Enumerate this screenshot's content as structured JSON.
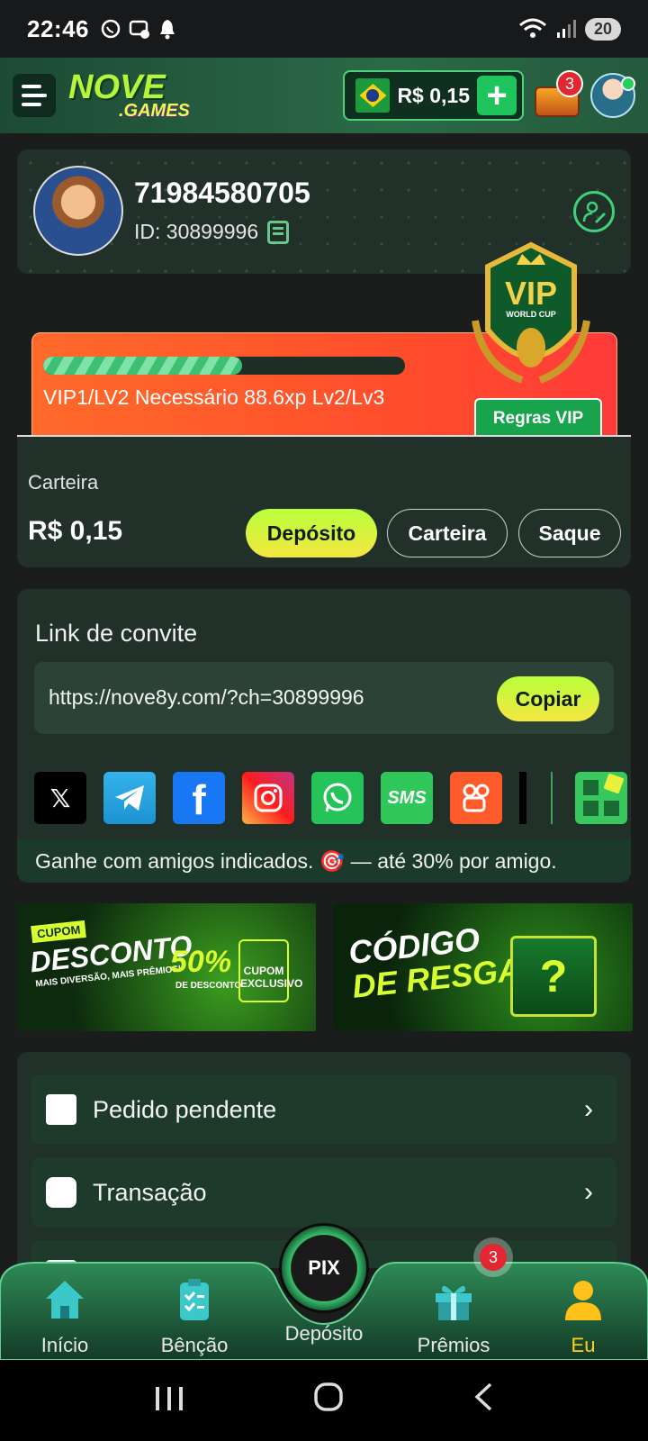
{
  "status_bar": {
    "time": "22:46",
    "battery": "20"
  },
  "header": {
    "logo_main": "NOVE",
    "logo_sub": ".GAMES",
    "balance": "R$ 0,15",
    "chest_badge": "3"
  },
  "profile": {
    "username": "71984580705",
    "id_label": "ID: 30899996"
  },
  "vip": {
    "progress": 0.55,
    "text": "VIP1/LV2  Necessário 88.6xp Lv2/Lv3",
    "rules_label": "Regras VIP",
    "badge_text": "VIP",
    "badge_sub": "WORLD CUP"
  },
  "wallet": {
    "label": "Carteira",
    "amount": "R$ 0,15",
    "deposit_label": "Depósito",
    "wallet_label": "Carteira",
    "withdraw_label": "Saque"
  },
  "invite": {
    "title": "Link de convite",
    "url": "https://nove8y.com/?ch=30899996",
    "copy_label": "Copiar",
    "socials": [
      "x-icon",
      "telegram-icon",
      "facebook-icon",
      "instagram-icon",
      "whatsapp-icon",
      "sms-icon",
      "kwai-icon",
      "more-apps-icon"
    ],
    "sms_text": "SMS",
    "footer": "Ganhe com amigos indicados. 🎯 — até 30% por amigo."
  },
  "banners": {
    "coupon": {
      "tag": "CUPOM",
      "title": "DESCONTO",
      "sub": "MAIS DIVERSÃO, MAIS PRÊMIOS!",
      "pct": "50%",
      "pct_sub": "DE DESCONTO",
      "cupom": "CUPOM EXCLUSIVO"
    },
    "redeem": {
      "line1": "CÓDIGO",
      "line2": "DE RESGATE"
    }
  },
  "menu": [
    {
      "label": "Pedido pendente"
    },
    {
      "label": "Transação"
    }
  ],
  "bottom_nav": {
    "home": "Início",
    "blessing": "Bênção",
    "deposit": "Depósito",
    "prizes": "Prêmios",
    "me": "Eu",
    "pix": "PIX",
    "prizes_badge": "3"
  },
  "colors": {
    "accent": "#3fd17a",
    "brand_yellow": "#f5e642",
    "active_nav": "#ffd21a"
  }
}
